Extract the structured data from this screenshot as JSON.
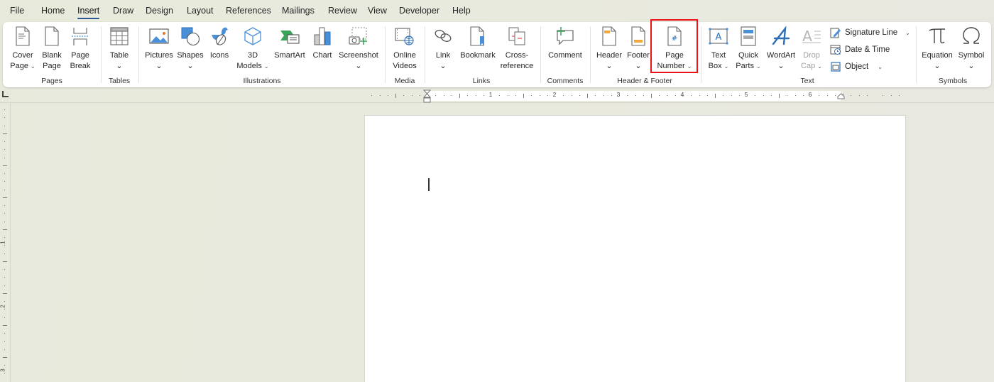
{
  "menu": {
    "tabs": [
      {
        "label": "File"
      },
      {
        "label": "Home"
      },
      {
        "label": "Insert",
        "active": true
      },
      {
        "label": "Draw"
      },
      {
        "label": "Design"
      },
      {
        "label": "Layout"
      },
      {
        "label": "References"
      },
      {
        "label": "Mailings"
      },
      {
        "label": "Review"
      },
      {
        "label": "View"
      },
      {
        "label": "Developer"
      },
      {
        "label": "Help"
      }
    ]
  },
  "ribbon": {
    "groups": {
      "pages": "Pages",
      "tables": "Tables",
      "illustrations": "Illustrations",
      "media": "Media",
      "links": "Links",
      "comments": "Comments",
      "header_footer": "Header & Footer",
      "text": "Text",
      "symbols": "Symbols"
    },
    "buttons": {
      "cover_page": [
        "Cover",
        "Page"
      ],
      "blank_page": [
        "Blank",
        "Page"
      ],
      "page_break": [
        "Page",
        "Break"
      ],
      "table": [
        "Table"
      ],
      "pictures": [
        "Pictures"
      ],
      "shapes": [
        "Shapes"
      ],
      "icons": [
        "Icons"
      ],
      "models_3d": [
        "3D",
        "Models"
      ],
      "smartart": [
        "SmartArt"
      ],
      "chart": [
        "Chart"
      ],
      "screenshot": [
        "Screenshot"
      ],
      "online_videos": [
        "Online",
        "Videos"
      ],
      "link": [
        "Link"
      ],
      "bookmark": [
        "Bookmark"
      ],
      "cross_reference": [
        "Cross-",
        "reference"
      ],
      "comment": [
        "Comment"
      ],
      "header": [
        "Header"
      ],
      "footer": [
        "Footer"
      ],
      "page_number": [
        "Page",
        "Number"
      ],
      "text_box": [
        "Text",
        "Box"
      ],
      "quick_parts": [
        "Quick",
        "Parts"
      ],
      "wordart": [
        "WordArt"
      ],
      "drop_cap": [
        "Drop",
        "Cap"
      ],
      "signature_line": "Signature Line",
      "date_time": "Date & Time",
      "object": "Object",
      "equation": [
        "Equation"
      ],
      "symbol": [
        "Symbol"
      ]
    },
    "chevron": "⌄",
    "highlighted_button": "Page Number",
    "highlight_color": "#e8141a",
    "accent_color": "#2b5797"
  },
  "ruler": {
    "horizontal_numbers": [
      "1",
      "2",
      "3",
      "4",
      "5",
      "6"
    ],
    "vertical_numbers": [
      "1",
      "2",
      "3"
    ]
  },
  "document": {
    "content": ""
  }
}
